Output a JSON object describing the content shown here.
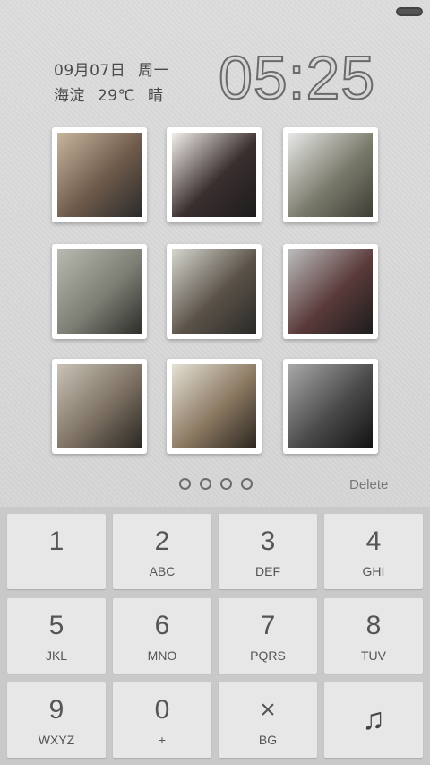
{
  "status": {
    "battery_icon": "battery-pill-icon"
  },
  "lock": {
    "date": "09月07日",
    "weekday": "周一",
    "location": "海淀",
    "temperature": "29℃",
    "weather": "晴",
    "time": "05:25"
  },
  "photos": [
    {
      "name": "photo-camera-boy",
      "colors": [
        "#c8b59e",
        "#6e5a4a",
        "#2b2b2b"
      ]
    },
    {
      "name": "photo-boy-profile",
      "colors": [
        "#f2efe9",
        "#3a2f2f",
        "#1c1c1c"
      ]
    },
    {
      "name": "photo-road-sign",
      "colors": [
        "#e8e8e8",
        "#7b7b6c",
        "#3d3d35"
      ]
    },
    {
      "name": "photo-fence-bike",
      "colors": [
        "#b9b9b0",
        "#7c7e74",
        "#2e2e2a"
      ]
    },
    {
      "name": "photo-backpack",
      "colors": [
        "#d5d5ce",
        "#5a5248",
        "#2a2a28"
      ]
    },
    {
      "name": "photo-hoodie",
      "colors": [
        "#bcbcbc",
        "#5a3a3a",
        "#1d1d1d"
      ]
    },
    {
      "name": "photo-kneeling",
      "colors": [
        "#c9c3b6",
        "#7c7062",
        "#2a2722"
      ]
    },
    {
      "name": "photo-guitar",
      "colors": [
        "#e5e1d6",
        "#8a7760",
        "#2b2620"
      ]
    },
    {
      "name": "photo-sunglasses",
      "colors": [
        "#a8a8a8",
        "#4a4a4a",
        "#121212"
      ]
    }
  ],
  "pager": {
    "count": 4
  },
  "delete_label": "Delete",
  "keys": [
    {
      "num": "1",
      "sub": ""
    },
    {
      "num": "2",
      "sub": "ABC"
    },
    {
      "num": "3",
      "sub": "DEF"
    },
    {
      "num": "4",
      "sub": "GHI"
    },
    {
      "num": "5",
      "sub": "JKL"
    },
    {
      "num": "6",
      "sub": "MNO"
    },
    {
      "num": "7",
      "sub": "PQRS"
    },
    {
      "num": "8",
      "sub": "TUV"
    },
    {
      "num": "9",
      "sub": "WXYZ"
    },
    {
      "num": "0",
      "sub": "+"
    },
    {
      "num": "×",
      "sub": "BG"
    },
    {
      "num": "♫",
      "sub": ""
    }
  ]
}
